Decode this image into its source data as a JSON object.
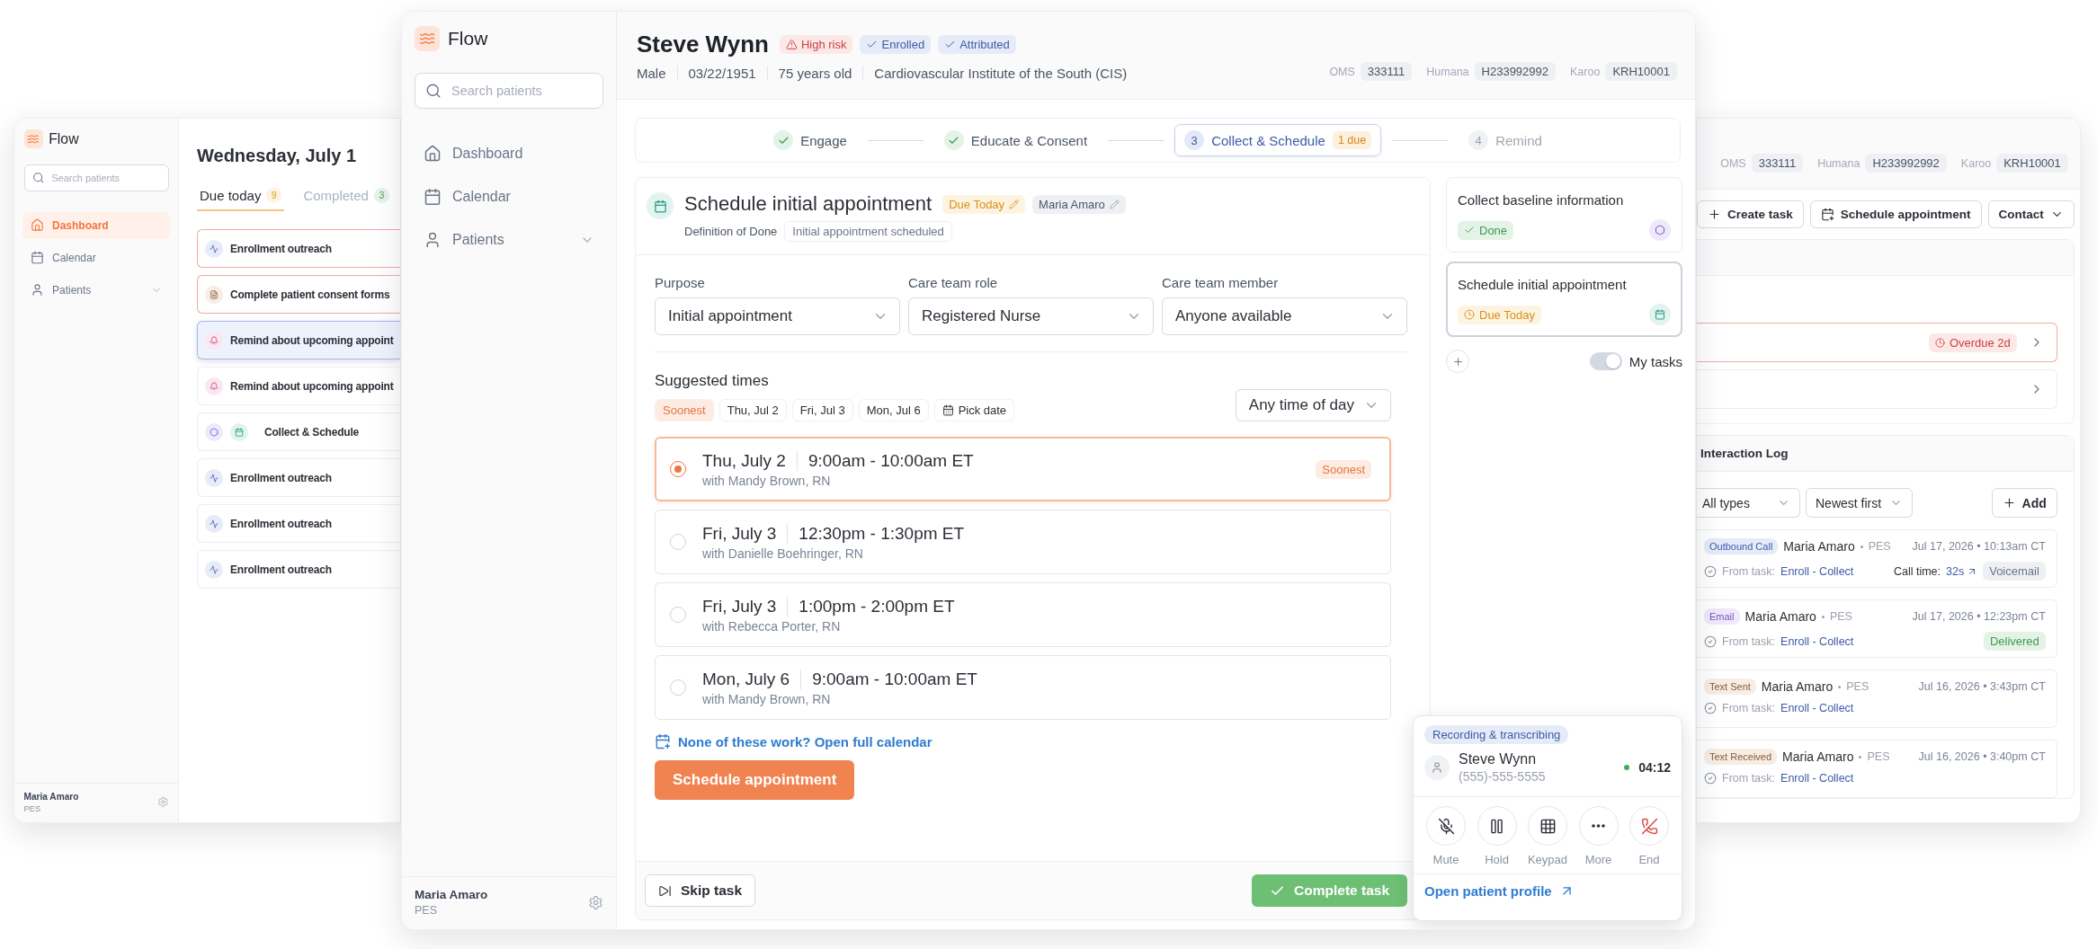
{
  "left_window": {
    "logo": "Flow",
    "search": {
      "placeholder": "Search patients"
    },
    "nav": [
      {
        "kind": "home",
        "label": "Dashboard",
        "selected": true
      },
      {
        "kind": "calendar",
        "label": "Calendar",
        "selected": false
      },
      {
        "kind": "patients",
        "label": "Patients",
        "selected": false
      }
    ],
    "user": {
      "name": "Maria Amaro",
      "role": "PES"
    },
    "date_title": "Wednesday, July 1",
    "tabs": [
      {
        "label": "Due today",
        "count": "9",
        "kind": "due",
        "selected": true
      },
      {
        "label": "Completed",
        "count": "3",
        "kind": "completed",
        "selected": false
      }
    ],
    "tasks": [
      {
        "kind": "outreach",
        "label": "Enrollment outreach",
        "overdue": true,
        "selected": false
      },
      {
        "kind": "consent",
        "label": "Complete patient consent forms",
        "overdue": true,
        "selected": false
      },
      {
        "kind": "reminder",
        "label": "Remind about upcoming appoint",
        "overdue": false,
        "selected": true
      },
      {
        "kind": "reminder",
        "label": "Remind about upcoming appoint",
        "overdue": false,
        "selected": false
      },
      {
        "kind": "collect",
        "label": "Collect & Schedule",
        "overdue": false,
        "selected": false
      },
      {
        "kind": "outreach",
        "label": "Enrollment outreach",
        "overdue": false,
        "selected": false
      },
      {
        "kind": "outreach",
        "label": "Enrollment outreach",
        "overdue": false,
        "selected": false
      },
      {
        "kind": "outreach",
        "label": "Enrollment outreach",
        "overdue": false,
        "selected": false
      }
    ]
  },
  "main_window": {
    "logo": "Flow",
    "search": {
      "placeholder": "Search patients"
    },
    "nav": [
      {
        "kind": "home",
        "label": "Dashboard",
        "selected": false
      },
      {
        "kind": "calendar",
        "label": "Calendar",
        "selected": false
      },
      {
        "kind": "patients",
        "label": "Patients",
        "selected": false
      }
    ],
    "user": {
      "name": "Maria Amaro",
      "role": "PES"
    },
    "patient": {
      "name": "Steve Wynn",
      "badges": [
        {
          "kind": "risk",
          "label": "High risk"
        },
        {
          "kind": "check",
          "label": "Enrolled"
        },
        {
          "kind": "check",
          "label": "Attributed"
        }
      ],
      "details": [
        "Male",
        "03/22/1951",
        "75 years old",
        "Cardiovascular Institute of the South (CIS)"
      ],
      "ids": [
        {
          "label": "OMS",
          "value": "333111"
        },
        {
          "label": "Humana",
          "value": "H233992992"
        },
        {
          "label": "Karoo",
          "value": "KRH10001"
        }
      ]
    },
    "steps": [
      {
        "label": "Engage",
        "done": true,
        "current": false
      },
      {
        "label": "Educate & Consent",
        "done": true,
        "current": false
      },
      {
        "number": "3",
        "label": "Collect & Schedule",
        "done": false,
        "current": true,
        "due": "1 due"
      },
      {
        "number": "4",
        "label": "Remind",
        "done": false,
        "current": false
      }
    ],
    "task": {
      "title": "Schedule initial appointment",
      "due": "Due Today",
      "assignee": "Maria Amaro",
      "dod_label": "Definition of Done",
      "dod_value": "Initial appointment scheduled",
      "fields": [
        {
          "label": "Purpose",
          "value": "Initial appointment"
        },
        {
          "label": "Care team role",
          "value": "Registered Nurse"
        },
        {
          "label": "Care team member",
          "value": "Anyone available"
        }
      ],
      "suggested_title": "Suggested times",
      "chips": [
        {
          "kind": "chip",
          "label": "Soonest",
          "selected": true
        },
        {
          "kind": "chip",
          "label": "Thu, Jul 2",
          "selected": false
        },
        {
          "kind": "chip",
          "label": "Fri, Jul 3",
          "selected": false
        },
        {
          "kind": "chip",
          "label": "Mon, Jul 6",
          "selected": false
        },
        {
          "kind": "date",
          "label": "Pick date",
          "selected": false
        }
      ],
      "time_filter": "Any time of day",
      "slots": [
        {
          "date": "Thu, July 2",
          "time": "9:00am - 10:00am ET",
          "with": "with Mandy Brown, RN",
          "tag": "Soonest",
          "selected": true
        },
        {
          "date": "Fri, July 3",
          "time": "12:30pm - 1:30pm ET",
          "with": "with Danielle Boehringer, RN",
          "selected": false
        },
        {
          "date": "Fri, July 3",
          "time": "1:00pm - 2:00pm ET",
          "with": "with Rebecca Porter, RN",
          "selected": false
        },
        {
          "date": "Mon, July 6",
          "time": "9:00am - 10:00am ET",
          "with": "with Mandy Brown, RN",
          "selected": false
        }
      ],
      "calendar_link": "None of these work? Open full calendar",
      "schedule_button": "Schedule appointment",
      "skip_button": "Skip task",
      "complete_button": "Complete task"
    },
    "task_list": [
      {
        "kind": "baseline",
        "title": "Collect baseline information",
        "status": {
          "kind": "done",
          "label": "Done"
        },
        "selected": false
      },
      {
        "kind": "appointment",
        "title": "Schedule initial appointment",
        "status": {
          "kind": "due",
          "label": "Due Today"
        },
        "selected": true
      }
    ],
    "my_tasks": {
      "label": "My tasks",
      "on": true
    },
    "call": {
      "status": "Recording & transcribing",
      "name": "Steve Wynn",
      "phone": "(555)-555-5555",
      "timer": "04:12",
      "actions": [
        {
          "kind": "mute",
          "label": "Mute"
        },
        {
          "kind": "hold",
          "label": "Hold"
        },
        {
          "kind": "keypad",
          "label": "Keypad"
        },
        {
          "kind": "more",
          "label": "More"
        },
        {
          "kind": "end",
          "label": "End"
        }
      ],
      "profile_link": "Open patient profile"
    }
  },
  "right_window": {
    "ids": [
      {
        "label": "OMS",
        "value": "333111"
      },
      {
        "label": "Humana",
        "value": "H233992992"
      },
      {
        "label": "Karoo",
        "value": "KRH10001"
      }
    ],
    "actions": [
      {
        "kind": "create",
        "label": "Create task"
      },
      {
        "kind": "schedule",
        "label": "Schedule appointment"
      },
      {
        "kind": "contact",
        "label": "Contact"
      }
    ],
    "rows": [
      {
        "overdue": true,
        "badge": "Overdue 2d"
      },
      {
        "overdue": false
      }
    ],
    "log": {
      "title": "Interaction Log",
      "filters": [
        "All types",
        "Newest first"
      ],
      "add_button": "Add",
      "entries": [
        {
          "kind": "call",
          "type": "Outbound Call",
          "name": "Maria Amaro",
          "role": "PES",
          "timestamp": "Jul 17, 2026 • 10:13am CT",
          "from_label": "From task:",
          "task": "Enroll - Collect",
          "call_time_label": "Call time:",
          "call_time": "32s",
          "status": {
            "kind": "neutral",
            "label": "Voicemail"
          }
        },
        {
          "kind": "email",
          "type": "Email",
          "name": "Maria Amaro",
          "role": "PES",
          "timestamp": "Jul 17, 2026 • 12:23pm CT",
          "from_label": "From task:",
          "task": "Enroll - Collect",
          "status": {
            "kind": "success",
            "label": "Delivered"
          }
        },
        {
          "kind": "text",
          "type": "Text Sent",
          "name": "Maria Amaro",
          "role": "PES",
          "timestamp": "Jul 16, 2026 • 3:43pm CT",
          "from_label": "From task:",
          "task": "Enroll - Collect"
        },
        {
          "kind": "text",
          "type": "Text Received",
          "name": "Maria Amaro",
          "role": "PES",
          "timestamp": "Jul 16, 2026 • 3:40pm CT",
          "from_label": "From task:",
          "task": "Enroll - Collect"
        }
      ]
    }
  }
}
